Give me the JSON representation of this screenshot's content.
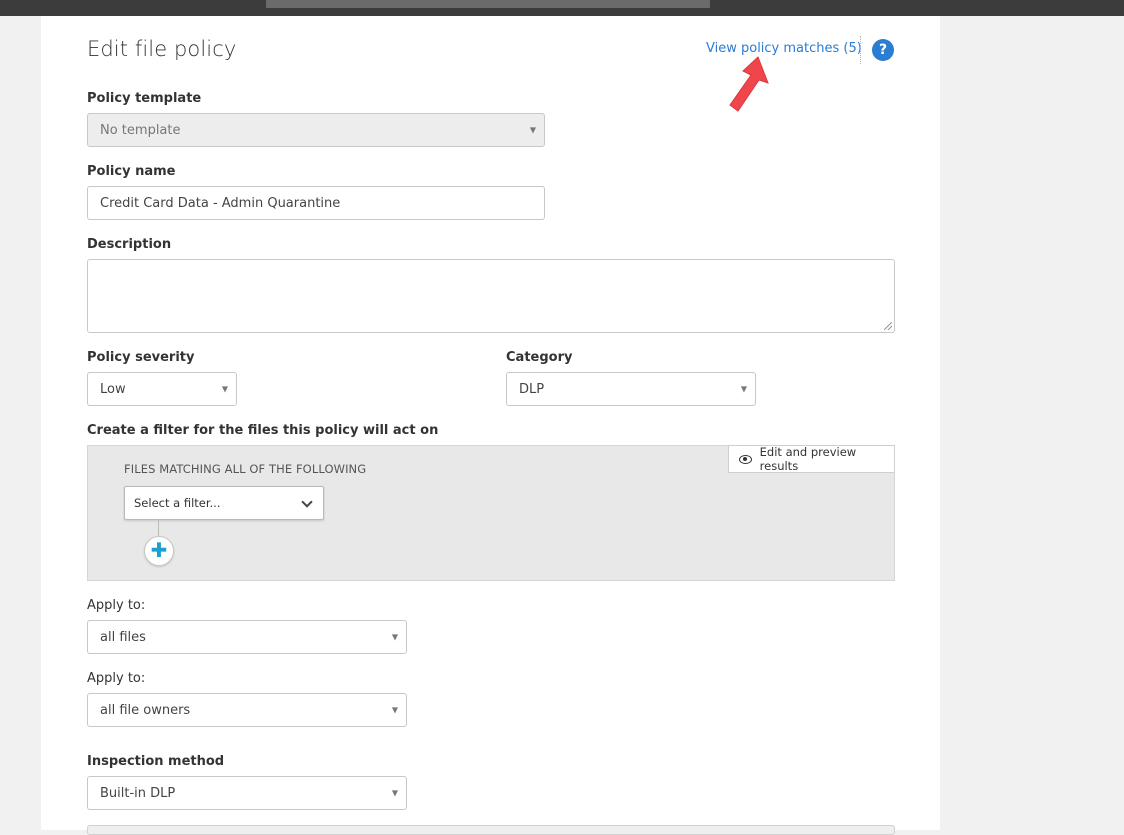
{
  "header": {
    "title": "Edit file policy",
    "view_matches_link": "View policy matches (5)",
    "help_icon": "?"
  },
  "policy_template": {
    "label": "Policy template",
    "value": "No template"
  },
  "policy_name": {
    "label": "Policy name",
    "value": "Credit Card Data - Admin Quarantine"
  },
  "description": {
    "label": "Description",
    "value": ""
  },
  "policy_severity": {
    "label": "Policy severity",
    "value": "Low"
  },
  "category": {
    "label": "Category",
    "value": "DLP"
  },
  "filter": {
    "label": "Create a filter for the files this policy will act on",
    "heading": "FILES MATCHING ALL OF THE FOLLOWING",
    "preview_button": "Edit and preview results",
    "select_placeholder": "Select a filter...",
    "add_icon": "✚"
  },
  "apply_to_files": {
    "label": "Apply to:",
    "value": "all files"
  },
  "apply_to_owners": {
    "label": "Apply to:",
    "value": "all file owners"
  },
  "inspection_method": {
    "label": "Inspection method",
    "value": "Built-in DLP"
  },
  "colors": {
    "link": "#2b7cd3",
    "help_bg": "#2b7cd3",
    "arrow": "#f0454a",
    "plus": "#1aa0d0"
  },
  "icons": [
    "help-icon",
    "caret-down-icon",
    "eye-icon",
    "chevron-down-icon",
    "plus-icon",
    "red-arrow-annotation"
  ]
}
